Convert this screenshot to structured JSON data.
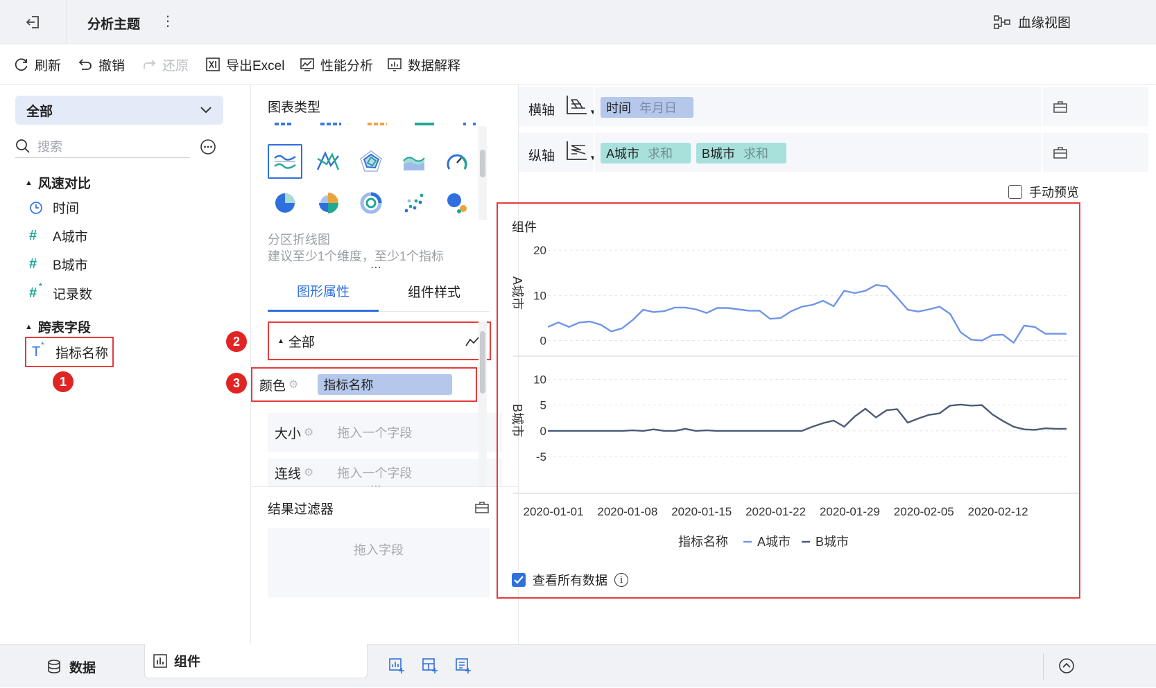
{
  "topbar": {
    "title": "分析主题",
    "more": "⋮",
    "lineage_label": "血缘视图"
  },
  "toolbar": {
    "refresh": "刷新",
    "undo": "撤销",
    "redo": "还原",
    "export": "导出Excel",
    "performance": "性能分析",
    "explain": "数据解释"
  },
  "left": {
    "dropdown": "全部",
    "search_placeholder": "搜索",
    "groups": [
      {
        "title": "风速对比",
        "fields": [
          {
            "icon": "clock-icon",
            "label": "时间"
          },
          {
            "icon": "hash-icon",
            "label": "A城市"
          },
          {
            "icon": "hash-icon",
            "label": "B城市"
          },
          {
            "icon": "hash-star-icon",
            "label": "记录数"
          }
        ]
      },
      {
        "title": "跨表字段",
        "fields": [
          {
            "icon": "text-star-icon",
            "label": "指标名称"
          }
        ]
      }
    ],
    "badge": "1"
  },
  "mid": {
    "chart_type_title": "图表类型",
    "chart_name": "分区折线图",
    "chart_hint": "建议至少1个维度，至少1个指标",
    "tabs": [
      "图形属性",
      "组件样式"
    ],
    "all_label": "全部",
    "badge2": "2",
    "badge3": "3",
    "props": [
      {
        "label": "颜色",
        "value": "指标名称"
      },
      {
        "label": "大小",
        "value": "拖入一个字段"
      },
      {
        "label": "连线",
        "value": "拖入一个字段"
      }
    ],
    "filter_title": "结果过滤器",
    "filter_placeholder": "拖入字段"
  },
  "axes": {
    "x_label": "横轴",
    "x_field": "时间",
    "x_field_sub": "年月日",
    "y_label": "纵轴",
    "y_fields": [
      {
        "name": "A城市",
        "agg": "求和"
      },
      {
        "name": "B城市",
        "agg": "求和"
      }
    ]
  },
  "manual_preview": "手动预览",
  "component_title": "组件",
  "view_all_data": "查看所有数据",
  "info_icon": "i",
  "bottom": {
    "data_tab": "数据",
    "component_tab": "组件"
  },
  "colors": {
    "accent": "#2f6fde",
    "seriesA": "#6f95e8",
    "seriesB": "#4b5b77",
    "red": "#e63b3b",
    "pillY": "#a8e0dc",
    "pillX": "#b5c8ec"
  },
  "chart_data": {
    "type": "line",
    "subtype": "partitioned-line",
    "title": "",
    "xlabel": "",
    "x_tick_labels": [
      "2020-01-01",
      "2020-01-08",
      "2020-01-15",
      "2020-01-22",
      "2020-01-29",
      "2020-02-05",
      "2020-02-12"
    ],
    "x": [
      "2020-01-01",
      "2020-01-02",
      "2020-01-03",
      "2020-01-04",
      "2020-01-05",
      "2020-01-06",
      "2020-01-07",
      "2020-01-08",
      "2020-01-09",
      "2020-01-10",
      "2020-01-11",
      "2020-01-12",
      "2020-01-13",
      "2020-01-14",
      "2020-01-15",
      "2020-01-16",
      "2020-01-17",
      "2020-01-18",
      "2020-01-19",
      "2020-01-20",
      "2020-01-21",
      "2020-01-22",
      "2020-01-23",
      "2020-01-24",
      "2020-01-25",
      "2020-01-26",
      "2020-01-27",
      "2020-01-28",
      "2020-01-29",
      "2020-01-30",
      "2020-01-31",
      "2020-02-01",
      "2020-02-02",
      "2020-02-03",
      "2020-02-04",
      "2020-02-05",
      "2020-02-06",
      "2020-02-07",
      "2020-02-08",
      "2020-02-09",
      "2020-02-10",
      "2020-02-11",
      "2020-02-12",
      "2020-02-13",
      "2020-02-14",
      "2020-02-15",
      "2020-02-16",
      "2020-02-17",
      "2020-02-18",
      "2020-02-19"
    ],
    "legend_title": "指标名称",
    "legend_position": "bottom",
    "series": [
      {
        "name": "A城市",
        "axis_label": "A城市",
        "ylim": [
          -1,
          22
        ],
        "yticks": [
          0,
          10,
          20
        ],
        "values": [
          3,
          4,
          3,
          4,
          4.2,
          3.5,
          2,
          2.7,
          4.5,
          6.8,
          6.3,
          6.5,
          7.3,
          7.3,
          6.9,
          6.1,
          7.2,
          7.2,
          6.9,
          6.6,
          6.6,
          4.8,
          5,
          6.5,
          7.5,
          7.9,
          8.8,
          7.6,
          11,
          10.5,
          11,
          12.3,
          12,
          9.5,
          6.8,
          6.4,
          6.9,
          7.5,
          5.9,
          1.8,
          0.2,
          0,
          1.2,
          1.3,
          -0.5,
          3.3,
          3,
          1.5,
          1.5,
          1.5
        ]
      },
      {
        "name": "B城市",
        "axis_label": "B城市",
        "ylim": [
          -7,
          11
        ],
        "yticks": [
          -5,
          0,
          5,
          10
        ],
        "values": [
          0,
          0,
          0,
          0,
          0,
          0,
          0,
          0,
          0.1,
          0,
          0.3,
          0,
          0,
          0.4,
          0,
          0.1,
          0,
          0,
          0,
          0,
          0,
          0,
          0,
          0,
          0,
          0.8,
          1.5,
          2,
          0.8,
          2.8,
          4.3,
          2.6,
          4,
          4.2,
          1.6,
          2.4,
          3.1,
          3.4,
          4.9,
          5.1,
          4.9,
          5,
          3.2,
          1.9,
          0.8,
          0.3,
          0.2,
          0.5,
          0.4,
          0.4
        ]
      }
    ]
  }
}
